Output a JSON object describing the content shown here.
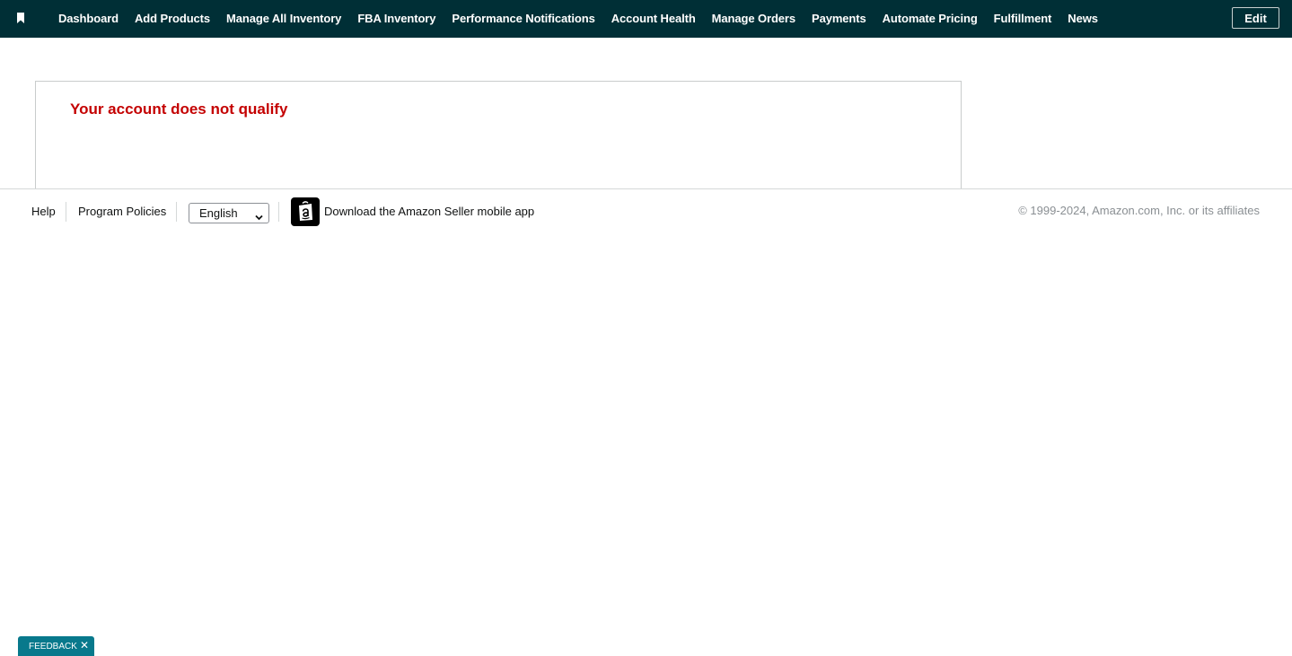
{
  "nav": {
    "items": [
      {
        "label": "Dashboard"
      },
      {
        "label": "Add Products"
      },
      {
        "label": "Manage All Inventory"
      },
      {
        "label": "FBA Inventory"
      },
      {
        "label": "Performance Notifications"
      },
      {
        "label": "Account Health"
      },
      {
        "label": "Manage Orders"
      },
      {
        "label": "Payments"
      },
      {
        "label": "Automate Pricing"
      },
      {
        "label": "Fulfillment"
      },
      {
        "label": "News"
      }
    ],
    "edit_label": "Edit",
    "bookmark_icon": "bookmark-icon"
  },
  "notice": {
    "title": "Your account does not qualify"
  },
  "footer": {
    "help_label": "Help",
    "policies_label": "Program Policies",
    "language_selected": "English",
    "app_icon": "amazon-app-icon",
    "app_link_label": "Download the Amazon Seller mobile app",
    "copyright": "© 1999-2024, Amazon.com, Inc. or its affiliates"
  },
  "feedback": {
    "label": "FEEDBACK",
    "close_symbol": "✕"
  },
  "colors": {
    "nav_background": "#002f36",
    "alert_red": "#c40000",
    "feedback_teal": "#08798c"
  }
}
